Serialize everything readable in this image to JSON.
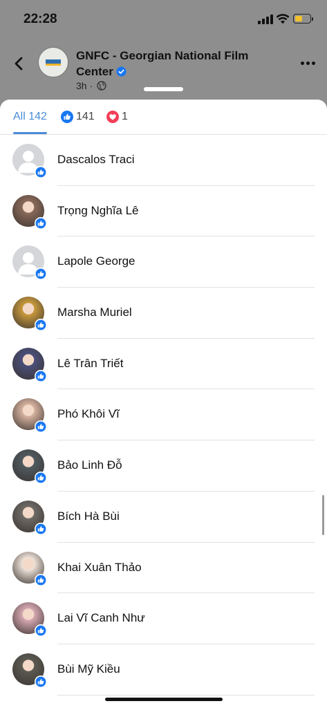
{
  "status_bar": {
    "time": "22:28",
    "battery_level": 0.55,
    "icons": [
      "signal-icon",
      "wifi-icon",
      "battery-icon"
    ]
  },
  "post": {
    "page_name": "GNFC - Georgian National Film Center",
    "meta": "3h ·",
    "icons": [
      "back-arrow-icon",
      "verified-badge-icon",
      "globe-icon",
      "more-options-icon"
    ]
  },
  "tabs": {
    "all_label": "All 142",
    "like_count": "141",
    "love_count": "1"
  },
  "reactors": [
    {
      "name": "Dascalos Traci",
      "avatar": "default",
      "reaction": "like"
    },
    {
      "name": "Trọng Nghĩa Lê",
      "avatar": "photo",
      "color": "#8a6a5a",
      "reaction": "like"
    },
    {
      "name": "Lapole George",
      "avatar": "default",
      "reaction": "like"
    },
    {
      "name": "Marsha Muriel",
      "avatar": "photo",
      "color": "#c99a3c",
      "reaction": "like"
    },
    {
      "name": "Lê Trân Triết",
      "avatar": "photo",
      "color": "#4a4f7a",
      "reaction": "like"
    },
    {
      "name": "Phó Khôi Vĩ",
      "avatar": "photo",
      "color": "#d8b3a0",
      "reaction": "like"
    },
    {
      "name": "Bảo Linh Đỗ",
      "avatar": "photo",
      "color": "#4f5a60",
      "reaction": "like"
    },
    {
      "name": "Bích Hà Bùi",
      "avatar": "photo",
      "color": "#6e6a66",
      "reaction": "like"
    },
    {
      "name": "Khai Xuân Thảo",
      "avatar": "photo",
      "color": "#efe4da",
      "reaction": "like"
    },
    {
      "name": "Lai Vĩ Canh Như",
      "avatar": "photo",
      "color": "#d7a9b2",
      "reaction": "like"
    },
    {
      "name": "Bùi Mỹ Kiều",
      "avatar": "photo",
      "color": "#5c5a52",
      "reaction": "like"
    }
  ],
  "colors": {
    "accent": "#4a8cd8",
    "like_blue": "#1877f2",
    "love_red": "#f33e58"
  }
}
